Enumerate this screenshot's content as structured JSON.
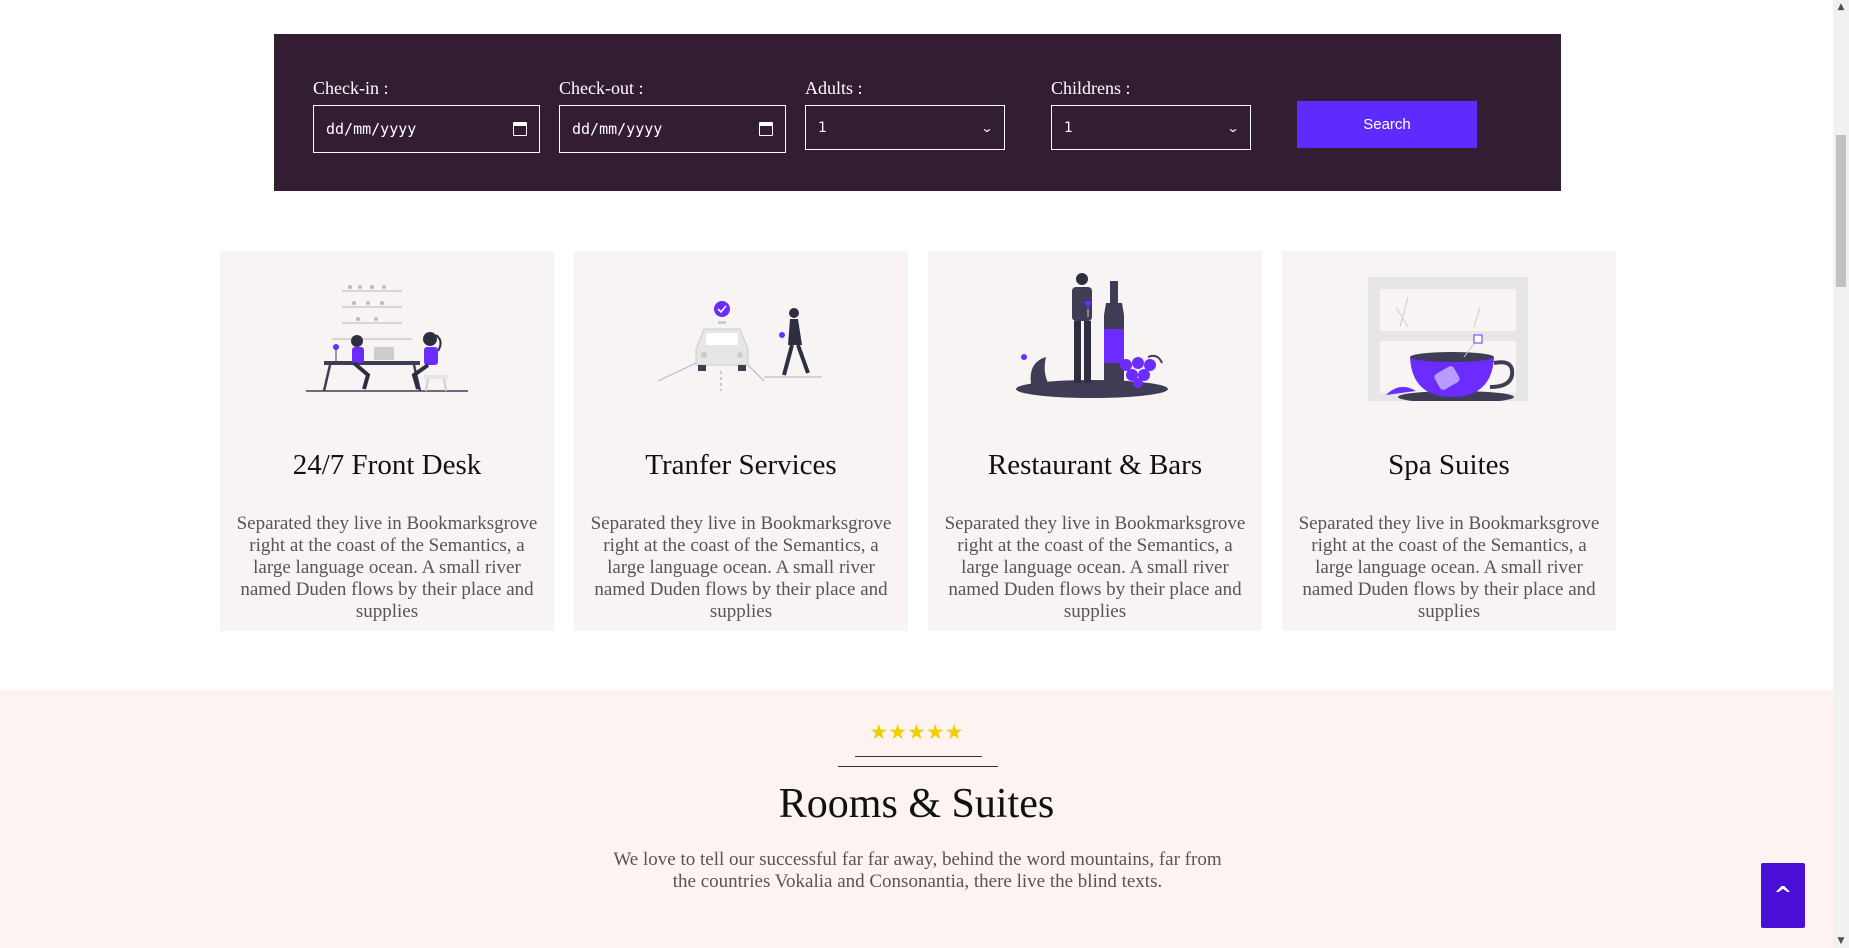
{
  "booking": {
    "checkin_label": "Check-in :",
    "checkin_value": "dd/mm/yyyy",
    "checkout_label": "Check-out :",
    "checkout_value": "dd/mm/yyyy",
    "adults_label": "Adults :",
    "adults_value": "1",
    "children_label": "Childrens :",
    "children_value": "1",
    "search_label": "Search"
  },
  "services": [
    {
      "title": "24/7 Front Desk",
      "text": "Separated they live in Bookmarksgrove right at the coast of the Semantics, a large language ocean. A small river named Duden flows by their place and supplies",
      "icon": "front-desk-illustration"
    },
    {
      "title": "Tranfer Services",
      "text": "Separated they live in Bookmarksgrove right at the coast of the Semantics, a large language ocean. A small river named Duden flows by their place and supplies",
      "icon": "car-transfer-illustration"
    },
    {
      "title": "Restaurant & Bars",
      "text": "Separated they live in Bookmarksgrove right at the coast of the Semantics, a large language ocean. A small river named Duden flows by their place and supplies",
      "icon": "wine-illustration"
    },
    {
      "title": "Spa Suites",
      "text": "Separated they live in Bookmarksgrove right at the coast of the Semantics, a large language ocean. A small river named Duden flows by their place and supplies",
      "icon": "tea-cup-illustration"
    }
  ],
  "rooms": {
    "stars": "★★★★★",
    "rating": 5,
    "title": "Rooms & Suites",
    "text": "We love to tell our successful far far away, behind the word mountains, far from the countries Vokalia and Consonantia, there live the blind texts."
  },
  "back_to_top_label": "^",
  "colors": {
    "booking_bg": "#331d33",
    "accent": "#5e2bff",
    "card_bg": "#f8f4f3",
    "rooms_bg": "#fdf3f1",
    "star": "#f2cf00",
    "top_button": "#4a0fd6"
  }
}
